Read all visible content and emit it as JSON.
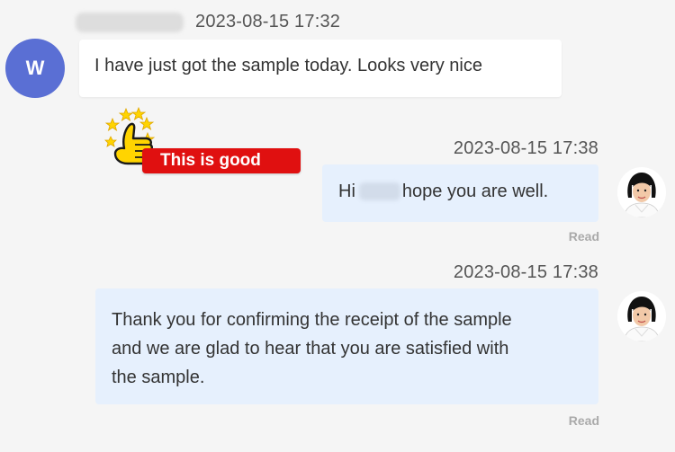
{
  "incoming": {
    "avatar_letter": "W",
    "timestamp": "2023-08-15 17:32",
    "text": "I have just got the sample today. Looks very nice"
  },
  "badge": {
    "label": "This is good"
  },
  "outgoing": [
    {
      "timestamp": "2023-08-15 17:38",
      "text_before": "Hi",
      "text_after": "hope you are well.",
      "status": "Read"
    },
    {
      "timestamp": "2023-08-15 17:38",
      "lines": [
        "Thank you for confirming the receipt of the sample",
        "and we are glad to hear that you are satisfied with",
        "the sample."
      ],
      "status": "Read"
    }
  ],
  "colors": {
    "background": "#f5f5f5",
    "incoming_bubble": "#ffffff",
    "outgoing_bubble": "#e6f0fd",
    "avatar_accent": "#5a6fd4",
    "badge_red": "#e01010",
    "thumb_yellow": "#ffd400"
  }
}
